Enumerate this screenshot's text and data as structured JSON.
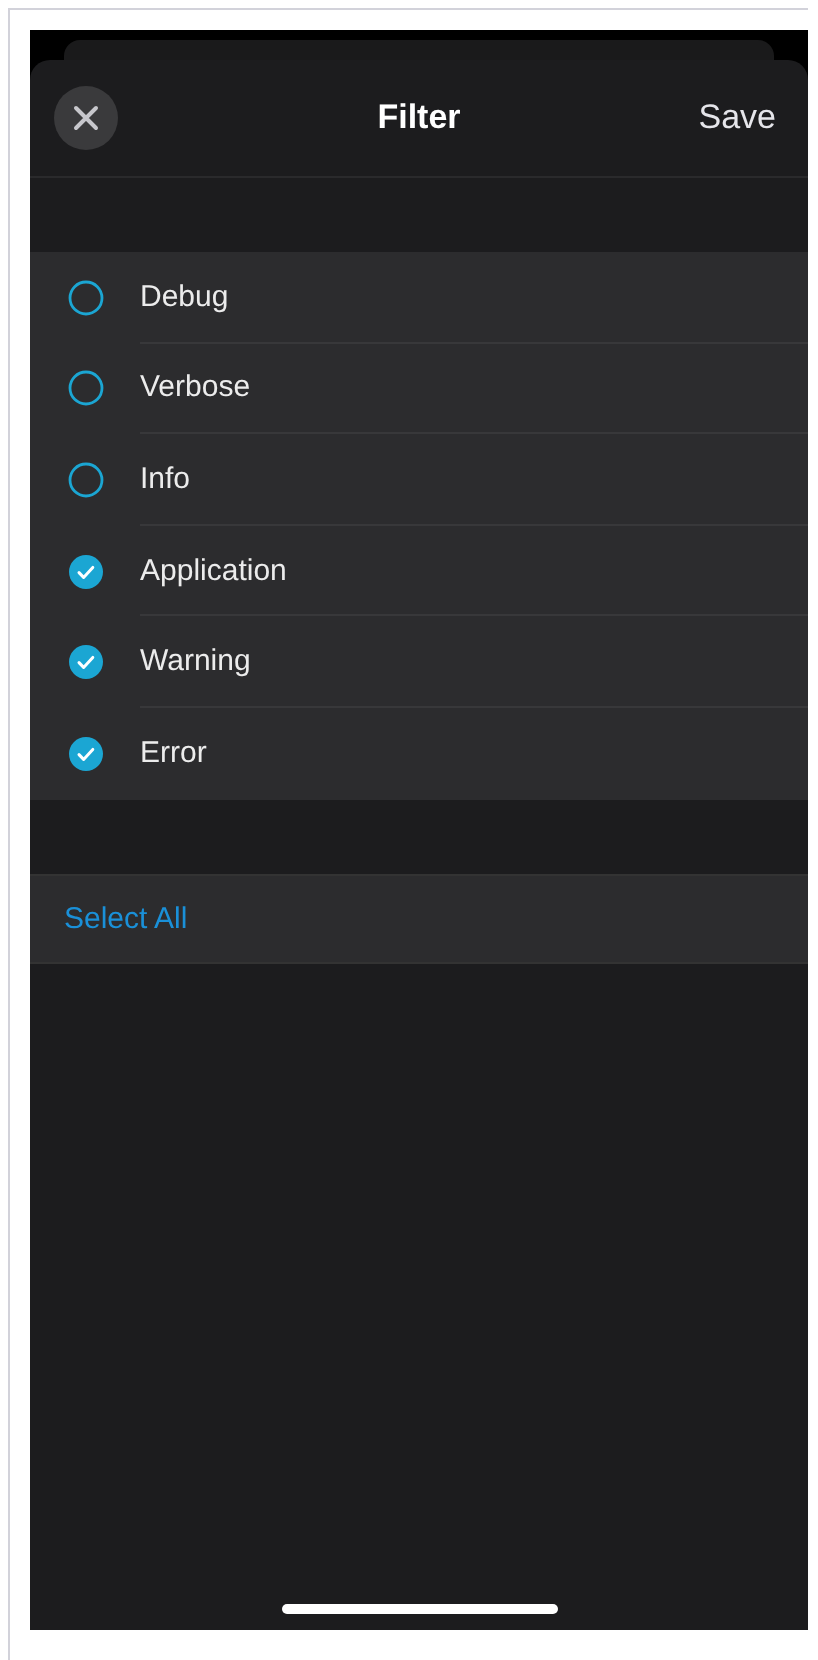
{
  "header": {
    "title": "Filter",
    "action": "Save"
  },
  "levels": [
    {
      "label": "Debug",
      "checked": false
    },
    {
      "label": "Verbose",
      "checked": false
    },
    {
      "label": "Info",
      "checked": false
    },
    {
      "label": "Application",
      "checked": true
    },
    {
      "label": "Warning",
      "checked": true
    },
    {
      "label": "Error",
      "checked": true
    }
  ],
  "select_all": "Select All"
}
